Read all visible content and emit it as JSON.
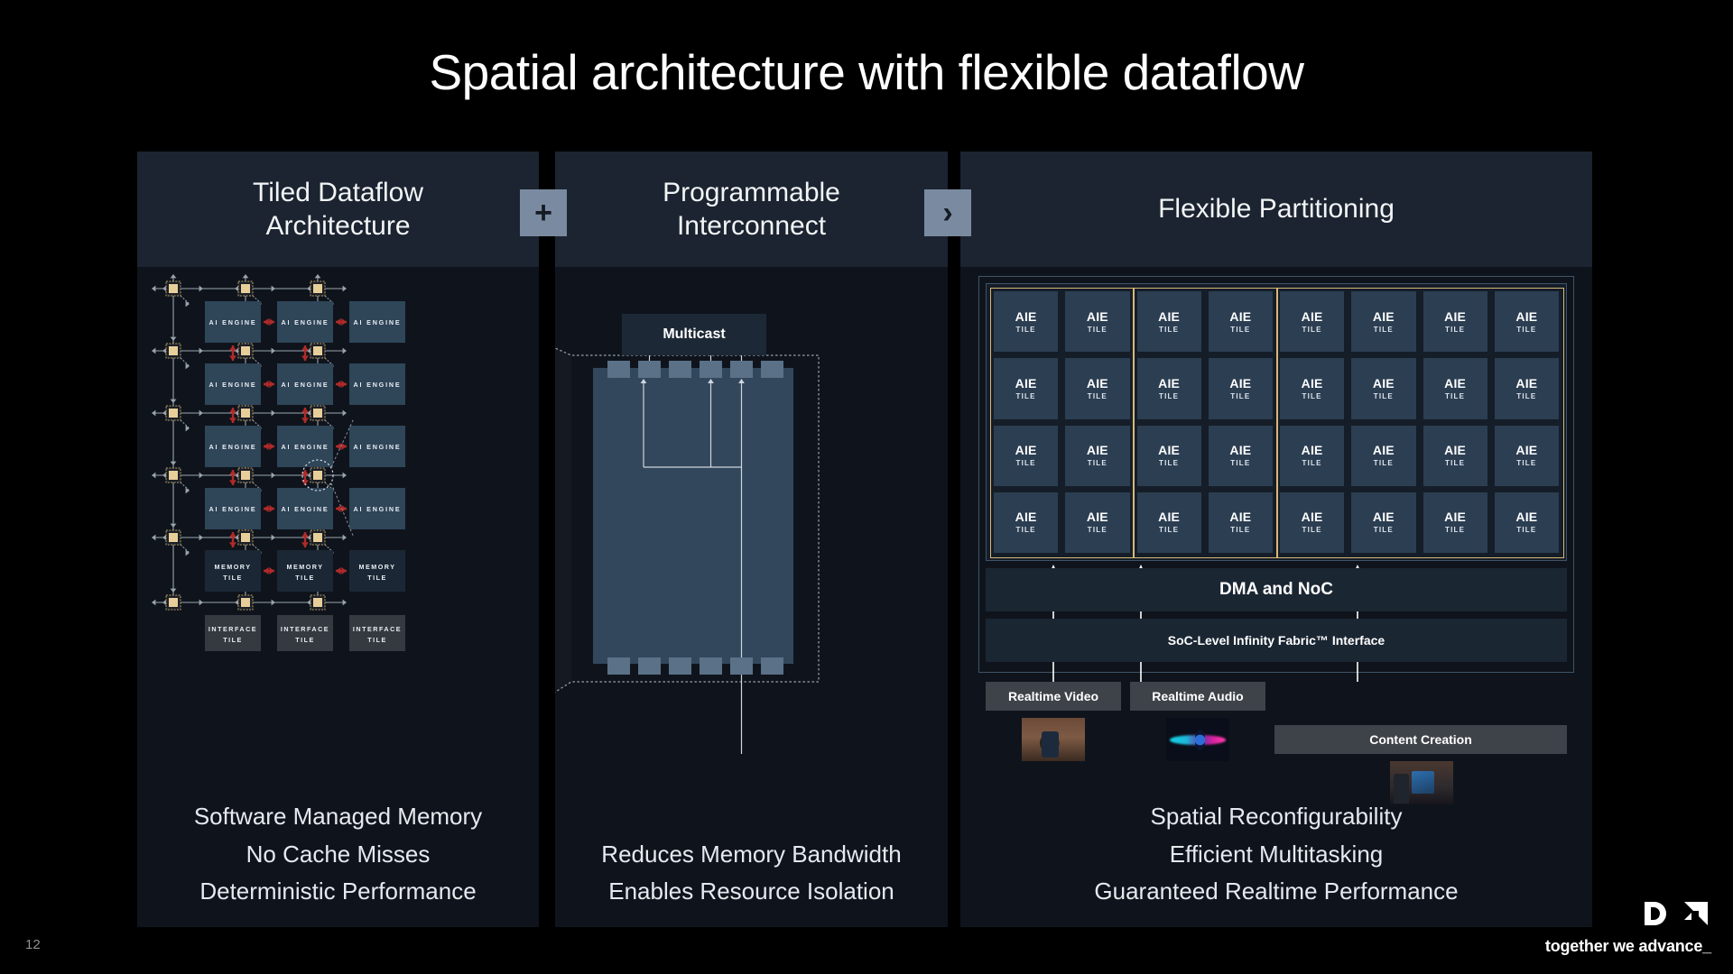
{
  "slide": {
    "title": "Spatial architecture with flexible dataflow",
    "page_number": "12",
    "background_color": "#000000",
    "panel_color": "#0f141c",
    "panel_header_color": "#1b2430"
  },
  "connectors": [
    {
      "name": "plus",
      "glyph": "+"
    },
    {
      "name": "chevron-right",
      "glyph": "›"
    }
  ],
  "panels": {
    "left": {
      "title_line1": "Tiled Dataflow",
      "title_line2": "Architecture",
      "captions": [
        "Software Managed Memory",
        "No Cache Misses",
        "Deterministic Performance"
      ],
      "diagram": {
        "ai_engine_label": "AI ENGINE",
        "memory_tile_label_line1": "MEMORY",
        "memory_tile_label_line2": "TILE",
        "interface_tile_label_line1": "INTERFACE",
        "interface_tile_label_line2": "TILE",
        "ai_engine_rows": 4,
        "ai_engine_cols": 3,
        "memory_tile_count": 3,
        "interface_tile_count": 3,
        "switch_rows": 6,
        "switch_cols": 3,
        "tile_fill": "#2f4558",
        "memory_fill": "#1b2735",
        "interface_fill": "#343a40",
        "switch_fill": "#e8cf9a",
        "link_color": "#b02a2a",
        "wire_color": "#9aa4ae"
      }
    },
    "middle": {
      "title_line1": "Programmable",
      "title_line2": "Interconnect",
      "captions": [
        "Reduces Memory Bandwidth",
        "Enables Resource Isolation"
      ],
      "diagram": {
        "multicast_label": "Multicast",
        "switch_fill": "#33475c",
        "port_fill": "#5a7188",
        "top_ports": 6,
        "bottom_ports": 6,
        "multicast_fanout": 3
      }
    },
    "right": {
      "title_line1": "Flexible Partitioning",
      "title_line2": "",
      "captions": [
        "Spatial Reconfigurability",
        "Efficient Multitasking",
        "Guaranteed Realtime Performance"
      ],
      "diagram": {
        "tile_label_line1": "AIE",
        "tile_label_line2": "TILE",
        "grid_cols": 8,
        "grid_rows": 4,
        "partition_widths": [
          2,
          2,
          4
        ],
        "partition_border_color": "#d8b877",
        "tile_fill": "#2c3e52",
        "dma_label": "DMA and NoC",
        "soc_label": "SoC-Level Infinity Fabric™ Interface",
        "workloads": [
          {
            "label": "Realtime Video",
            "thumb": "thumb-video"
          },
          {
            "label": "Realtime Audio",
            "thumb": "thumb-audio"
          },
          {
            "label": "Content Creation",
            "thumb": "thumb-content"
          }
        ]
      }
    }
  },
  "footer": {
    "logo_name": "amd-logo",
    "tagline": "together we advance_"
  }
}
